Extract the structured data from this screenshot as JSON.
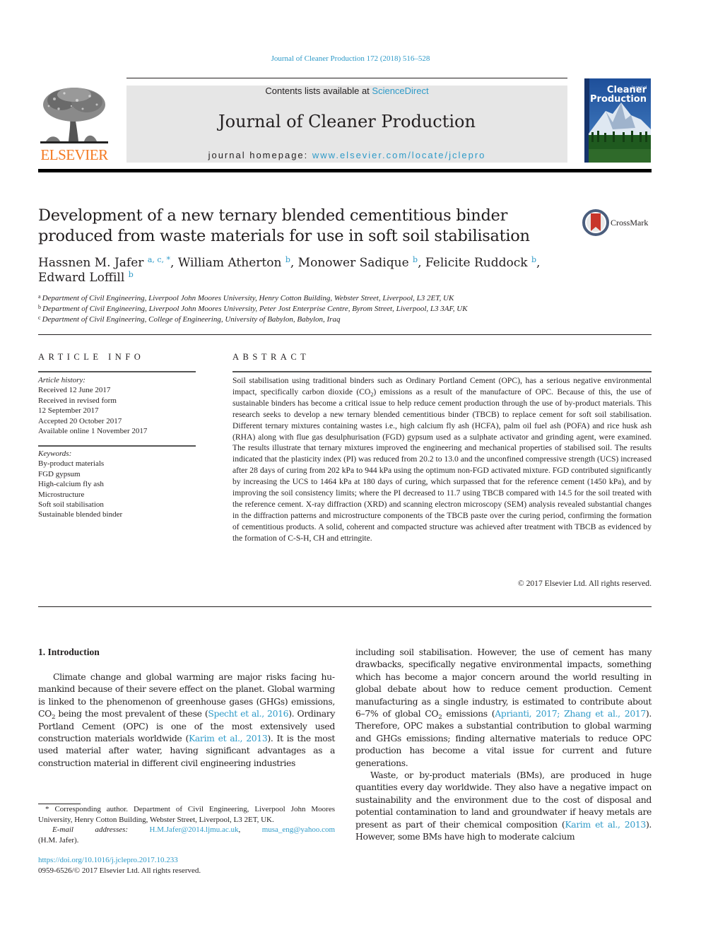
{
  "header": {
    "citation": "Journal of Cleaner Production 172 (2018) 516–528",
    "contents_prefix": "Contents lists available at ",
    "contents_link": "ScienceDirect",
    "journal_name": "Journal of Cleaner Production",
    "homepage_prefix": "journal homepage: ",
    "homepage_link": "www.elsevier.com/locate/jclepro",
    "publisher_logo": "ELSEVIER",
    "cover_title_line1": "Cleaner",
    "cover_title_line2": "Production",
    "brand_color": "#f47920",
    "link_color": "#2e9ac8"
  },
  "article": {
    "title": "Development of a new ternary blended cementitious binder produced from waste materials for use in soft soil stabilisation",
    "crossmark_label": "CrossMark",
    "authors": [
      {
        "name": "Hassnen M. Jafer",
        "sup": "a, c, *"
      },
      {
        "name": "William Atherton",
        "sup": "b"
      },
      {
        "name": "Monower Sadique",
        "sup": "b"
      },
      {
        "name": "Felicite Ruddock",
        "sup": "b"
      },
      {
        "name": "Edward Loffill",
        "sup": "b"
      }
    ],
    "affiliations": [
      {
        "key": "a",
        "text": "Department of Civil Engineering, Liverpool John Moores University, Henry Cotton Building, Webster Street, Liverpool, L3 2ET, UK"
      },
      {
        "key": "b",
        "text": "Department of Civil Engineering, Liverpool John Moores University, Peter Jost Enterprise Centre, Byrom Street, Liverpool, L3 3AF, UK"
      },
      {
        "key": "c",
        "text": "Department of Civil Engineering, College of Engineering, University of Babylon, Babylon, Iraq"
      }
    ]
  },
  "article_info": {
    "heading": "ARTICLE INFO",
    "history_label": "Article history:",
    "history": [
      "Received 12 June 2017",
      "Received in revised form",
      "12 September 2017",
      "Accepted 20 October 2017",
      "Available online 1 November 2017"
    ],
    "keywords_label": "Keywords:",
    "keywords": [
      "By-product materials",
      "FGD gypsum",
      "High-calcium fly ash",
      "Microstructure",
      "Soft soil stabilisation",
      "Sustainable blended binder"
    ]
  },
  "abstract": {
    "heading": "ABSTRACT",
    "text_1": "Soil stabilisation using traditional binders such as Ordinary Portland Cement (OPC), has a serious negative environmental impact, specifically carbon dioxide (CO",
    "sub_1": "2",
    "text_2": ") emissions as a result of the manufac­ture of OPC. Because of this, the use of sustainable binders has become a critical issue to help reduce cement production through the use of by-product materials. This research seeks to develop a new ternary blended cementitious binder (TBCB) to replace cement for soft soil stabilisation. Different ternary mixtures containing wastes i.e., high calcium fly ash (HCFA), palm oil fuel ash (POFA) and rice husk ash (RHA) along with flue gas desulphurisation (FGD) gypsum used as a sulphate activator and grinding agent, were examined. The results illustrate that ternary mixtures improved the engineering and me­chanical properties of stabilised soil. The results indicated that the plasticity index (PI) was reduced from 20.2 to 13.0 and the unconfined compressive strength (UCS) increased after 28 days of curing from 202 kPa to 944 kPa using the optimum non-FGD activated mixture. FGD contributed significantly by increasing the UCS to 1464 kPa at 180 days of curing, which surpassed that for the reference cement (1450 kPa), and by improving the soil consistency limits; where the PI decreased to 11.7 using TBCB compared with 14.5 for the soil treated with the reference cement. X-ray diffraction (XRD) and scanning electron microscopy (SEM) analysis revealed substantial changes in the diffraction patterns and micro­structure components of the TBCB paste over the curing period, confirming the formation of cementi­tious products. A solid, coherent and compacted structure was achieved after treatment with TBCB as evidenced by the formation of C-S-H, CH and ettringite.",
    "copyright": "© 2017 Elsevier Ltd. All rights reserved."
  },
  "introduction": {
    "heading": "1.  Introduction",
    "left": {
      "t1": "Climate change and global warming are major risks facing hu­mankind because of their severe effect on the planet. Global warming is linked to the phenomenon of greenhouse gases (GHGs) emissions, CO",
      "s1": "2",
      "t2": " being the most prevalent of these (",
      "ref1": "Specht et al., 2016",
      "t3": "). Ordinary Portland Cement (OPC) is one of the most exten­sively used construction materials worldwide (",
      "ref2": "Karim et al., 2013",
      "t4": "). It is the most used material after water, having significant advantages as a construction material in different civil engineering industries"
    },
    "right_p1": {
      "t1": "including soil stabilisation. However, the use of cement has many drawbacks, specifically negative environmental impacts, some­thing which has become a major concern around the world resulting in global debate about how to reduce cement production. Cement manufacturing as a single industry, is estimated to contribute about 6–7% of global CO",
      "s1": "2",
      "t2": " emissions (",
      "ref1": "Aprianti, 2017; Zhang et al., 2017",
      "t3": "). Therefore, OPC makes a substantial contribu­tion to global warming and GHGs emissions; finding alternative materials to reduce OPC production has become a vital issue for current and future generations."
    },
    "right_p2": {
      "t1": "Waste, or by-product materials (BMs), are produced in huge quantities every day worldwide. They also have a negative impact on sustainability and the environment due to the cost of disposal and potential contamination to land and groundwater if heavy metals are present as part of their chemical composition (",
      "ref1": "Karim et al., 2013",
      "t2": "). However, some BMs have high to moderate calcium"
    }
  },
  "footnote": {
    "corresponding": "* Corresponding author. Department of Civil Engineering, Liverpool John Moores University, Henry Cotton Building, Webster Street, Liverpool, L3 2ET, UK.",
    "email_label": "E-mail addresses:",
    "email_1": "H.M.Jafer@2014.ljmu.ac.uk",
    "email_2": "musa_eng@yahoo.com",
    "email_owner": "(H.M. Jafer).",
    "doi": "https://doi.org/10.1016/j.jclepro.2017.10.233",
    "issn": "0959-6526/© 2017 Elsevier Ltd. All rights reserved."
  }
}
